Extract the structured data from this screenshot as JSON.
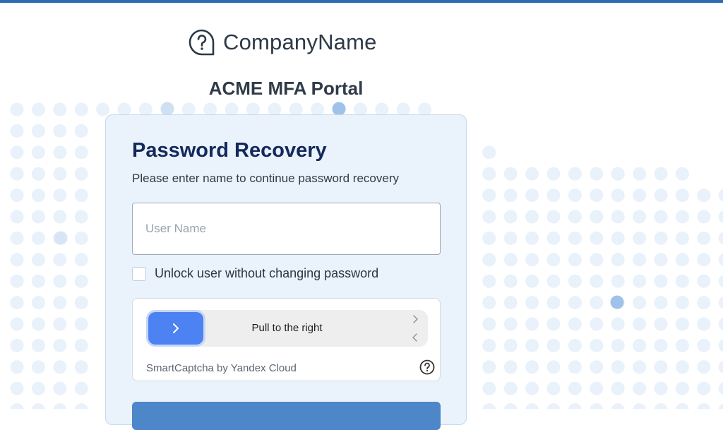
{
  "brand": {
    "name": "CompanyName",
    "icon": "question-bubble-icon"
  },
  "portal": {
    "title": "ACME MFA Portal"
  },
  "recovery": {
    "title": "Password Recovery",
    "subtitle": "Please enter name to continue password recovery",
    "username_placeholder": "User Name",
    "username_value": "",
    "unlock_checkbox_label": "Unlock user without changing password",
    "unlock_checked": false,
    "submit_label": ""
  },
  "captcha": {
    "slider_text": "Pull to the right",
    "brand_text": "SmartCaptcha by Yandex Cloud",
    "handle_icon": "chevron-right-icon",
    "help_icon": "question-circle-icon"
  },
  "colors": {
    "accent": "#4c82f2",
    "title": "#13295b",
    "card_bg": "#eaf2fb",
    "top_bar": "#2f6bb0"
  }
}
